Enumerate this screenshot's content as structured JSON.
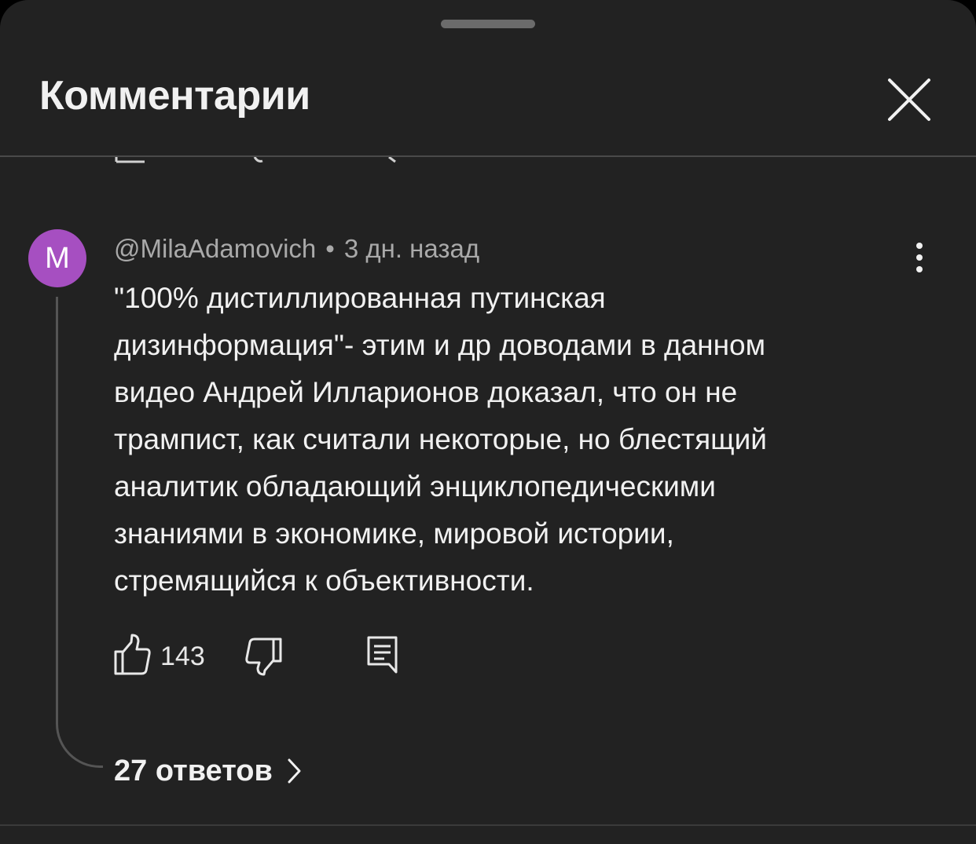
{
  "sheet": {
    "title": "Комментарии"
  },
  "comment": {
    "avatar_letter": "M",
    "avatar_color": "#a64fc1",
    "author": "@MilaAdamovich",
    "separator": "•",
    "time": "3 дн. назад",
    "text": "\"100% дистиллированная путинская\nдизинформация\"- этим и др доводами в данном\nвидео Андрей Илларионов доказал, что он не\nтрампист, как считали некоторые, но блестящий\nаналитик обладающий энциклопедическими\nзнаниями в экономике,  мировой истории,\nстремящийся к объективности.",
    "likes": "143",
    "replies_label": "27 ответов"
  },
  "icons": {
    "close": "close-icon",
    "more": "more-vertical-icon",
    "like": "thumbs-up-icon",
    "dislike": "thumbs-down-icon",
    "reply": "comment-reply-icon",
    "chevron": "chevron-right-icon"
  },
  "colors": {
    "background": "#222222",
    "text_primary": "#f1f1f1",
    "text_secondary": "#a9a9a9"
  }
}
